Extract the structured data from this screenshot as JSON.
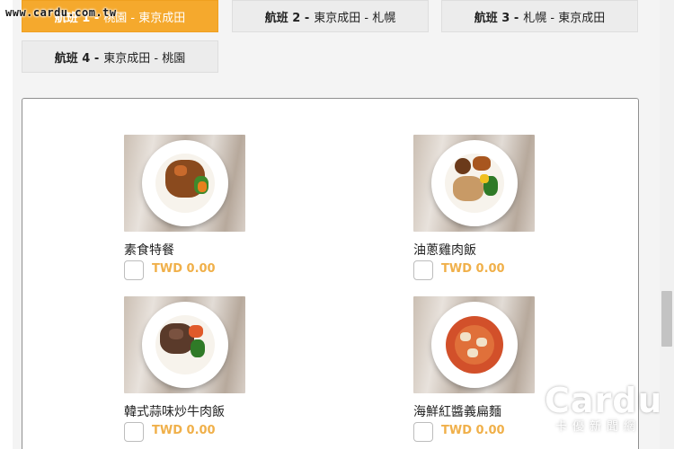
{
  "watermark": "www.cardu.com.tw",
  "tabs": [
    {
      "num": "航班 1 -",
      "route": "桃園 - 東京成田",
      "active": true
    },
    {
      "num": "航班 2 -",
      "route": "東京成田 - 札幌",
      "active": false
    },
    {
      "num": "航班 3 -",
      "route": "札幌 - 東京成田",
      "active": false
    },
    {
      "num": "航班 4 -",
      "route": "東京成田 - 桃園",
      "active": false
    }
  ],
  "meals": [
    {
      "name": "素食特餐",
      "price": "TWD 0.00"
    },
    {
      "name": "油蔥雞肉飯",
      "price": "TWD 0.00"
    },
    {
      "name": "韓式蒜味炒牛肉飯",
      "price": "TWD 0.00"
    },
    {
      "name": "海鮮紅醬義扁麵",
      "price": "TWD 0.00"
    }
  ],
  "brand": {
    "logo": "Cardu",
    "sub": "卡優新聞網"
  },
  "colors": {
    "accent": "#f5a92d",
    "price": "#f0b04a"
  }
}
